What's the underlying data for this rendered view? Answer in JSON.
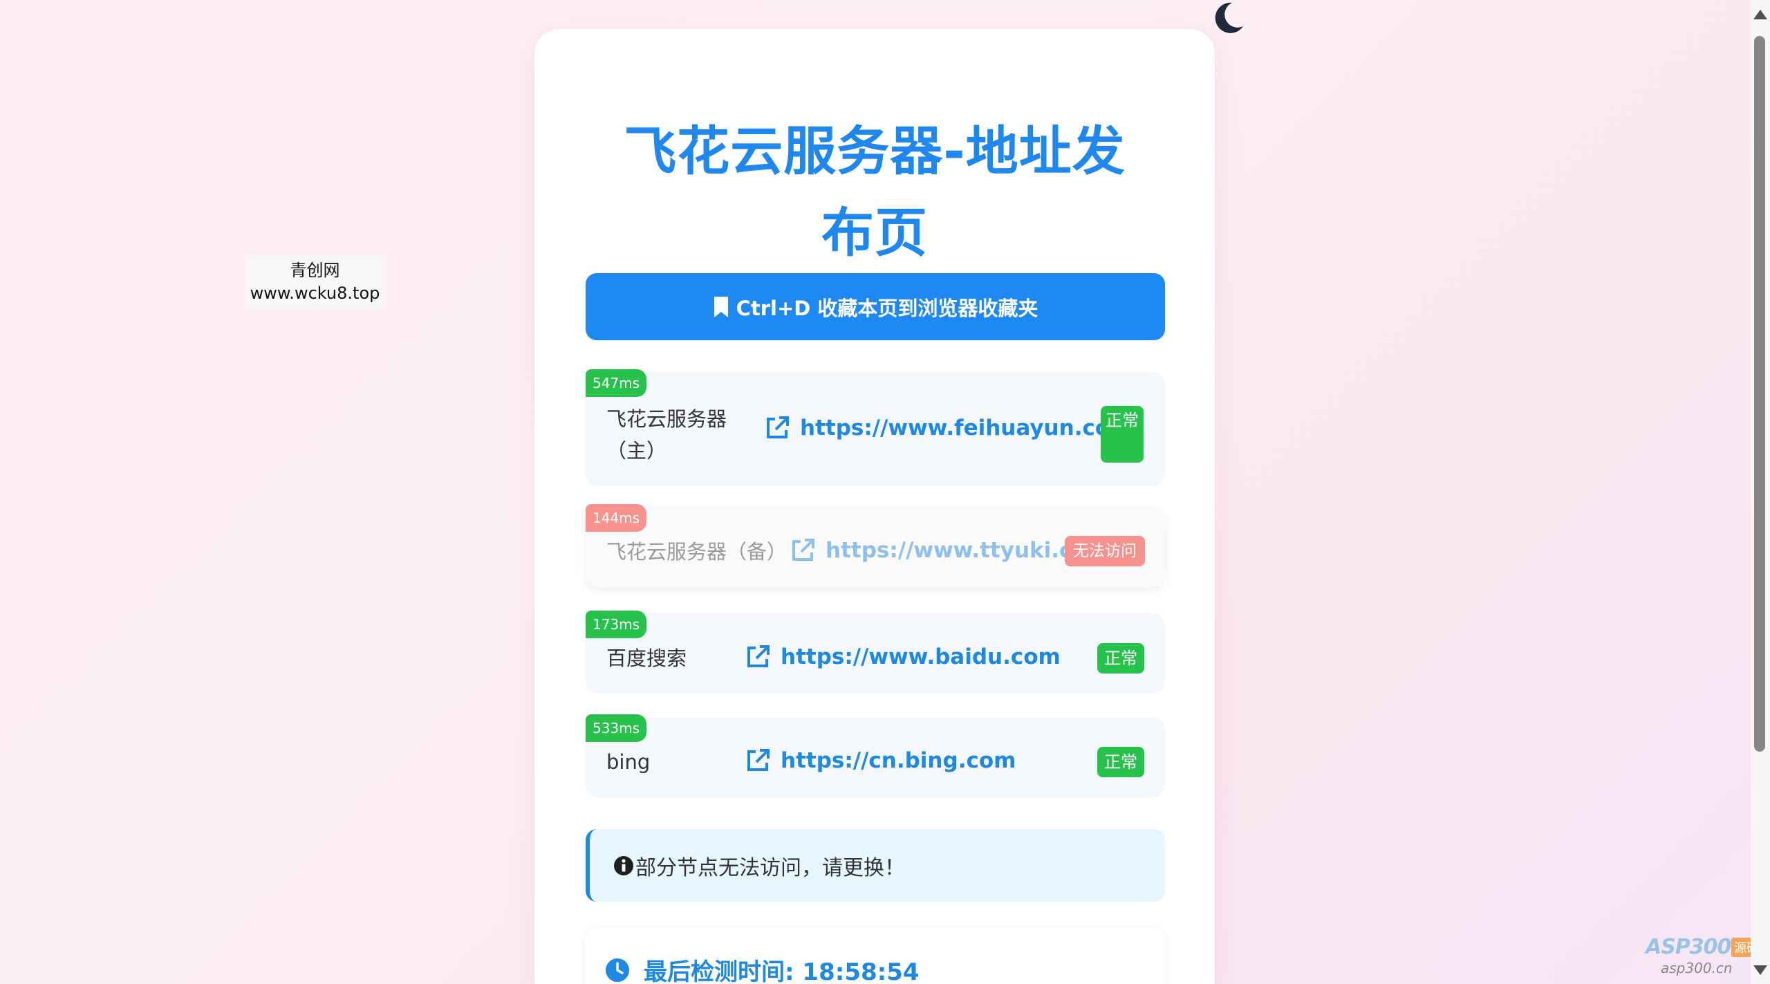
{
  "page": {
    "title": "飞花云服务器-地址发布页",
    "bookmark_button": "Ctrl+D 收藏本页到浏览器收藏夹"
  },
  "nodes": [
    {
      "name": "飞花云服务器（主）",
      "url": "https://www.feihuayun.com",
      "latency": "547ms",
      "status": "正常",
      "state": "ok"
    },
    {
      "name": "飞花云服务器（备）",
      "url": "https://www.ttyuki.cn",
      "latency": "144ms",
      "status": "无法访问",
      "state": "down"
    },
    {
      "name": "百度搜索",
      "url": "https://www.baidu.com",
      "latency": "173ms",
      "status": "正常",
      "state": "ok"
    },
    {
      "name": "bing",
      "url": "https://cn.bing.com",
      "latency": "533ms",
      "status": "正常",
      "state": "ok"
    }
  ],
  "notice": "部分节点无法访问，请更换！",
  "last_check": "最后检测时间: 18:58:54",
  "side_ad": {
    "line1": "青创网",
    "line2": "www.wcku8.top"
  },
  "watermark": {
    "logo": "ASP300",
    "tag": "源码",
    "url": "asp300.cn"
  },
  "colors": {
    "accent": "#1e88f5",
    "ok": "#27c24c",
    "down": "#f7928f"
  },
  "icons": {
    "theme_toggle": "moon-icon",
    "bookmark": "bookmark-icon",
    "link": "external-link-icon",
    "info": "info-circle-icon",
    "clock": "clock-icon"
  }
}
